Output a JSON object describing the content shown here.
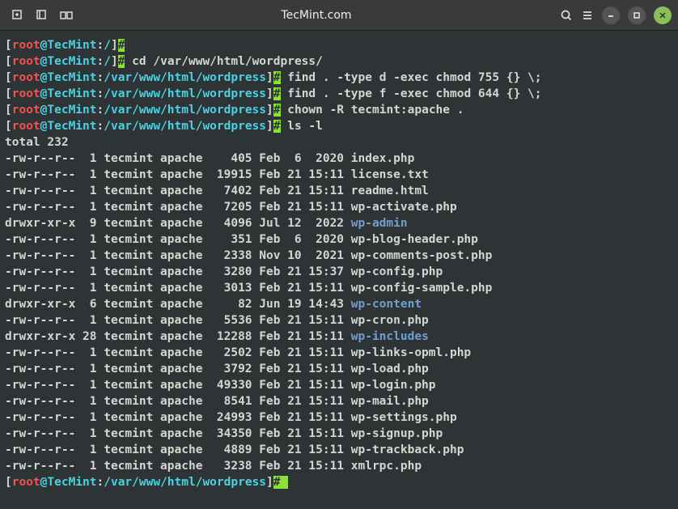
{
  "titlebar": {
    "title": "TecMint.com"
  },
  "prompts": [
    {
      "user": "root",
      "at": "@",
      "host": "TecMint",
      "sep": ":",
      "path": "/",
      "end": "]",
      "cmd": ""
    },
    {
      "user": "root",
      "at": "@",
      "host": "TecMint",
      "sep": ":",
      "path": "/",
      "end": "]",
      "cmd": " cd /var/www/html/wordpress/"
    },
    {
      "user": "root",
      "at": "@",
      "host": "TecMint",
      "sep": ":",
      "path": "/var/www/html/wordpress",
      "end": "]",
      "cmd": " find . -type d -exec chmod 755 {} \\;"
    },
    {
      "user": "root",
      "at": "@",
      "host": "TecMint",
      "sep": ":",
      "path": "/var/www/html/wordpress",
      "end": "]",
      "cmd": " find . -type f -exec chmod 644 {} \\;"
    },
    {
      "user": "root",
      "at": "@",
      "host": "TecMint",
      "sep": ":",
      "path": "/var/www/html/wordpress",
      "end": "]",
      "cmd": " chown -R tecmint:apache ."
    },
    {
      "user": "root",
      "at": "@",
      "host": "TecMint",
      "sep": ":",
      "path": "/var/www/html/wordpress",
      "end": "]",
      "cmd": " ls -l"
    }
  ],
  "total_line": "total 232",
  "files": [
    {
      "perm": "-rw-r--r--",
      "links": " 1",
      "user": "tecmint",
      "group": "apache",
      "size": "   405",
      "date": "Feb  6  2020",
      "name": "index.php",
      "dir": false
    },
    {
      "perm": "-rw-r--r--",
      "links": " 1",
      "user": "tecmint",
      "group": "apache",
      "size": " 19915",
      "date": "Feb 21 15:11",
      "name": "license.txt",
      "dir": false
    },
    {
      "perm": "-rw-r--r--",
      "links": " 1",
      "user": "tecmint",
      "group": "apache",
      "size": "  7402",
      "date": "Feb 21 15:11",
      "name": "readme.html",
      "dir": false
    },
    {
      "perm": "-rw-r--r--",
      "links": " 1",
      "user": "tecmint",
      "group": "apache",
      "size": "  7205",
      "date": "Feb 21 15:11",
      "name": "wp-activate.php",
      "dir": false
    },
    {
      "perm": "drwxr-xr-x",
      "links": " 9",
      "user": "tecmint",
      "group": "apache",
      "size": "  4096",
      "date": "Jul 12  2022",
      "name": "wp-admin",
      "dir": true
    },
    {
      "perm": "-rw-r--r--",
      "links": " 1",
      "user": "tecmint",
      "group": "apache",
      "size": "   351",
      "date": "Feb  6  2020",
      "name": "wp-blog-header.php",
      "dir": false
    },
    {
      "perm": "-rw-r--r--",
      "links": " 1",
      "user": "tecmint",
      "group": "apache",
      "size": "  2338",
      "date": "Nov 10  2021",
      "name": "wp-comments-post.php",
      "dir": false
    },
    {
      "perm": "-rw-r--r--",
      "links": " 1",
      "user": "tecmint",
      "group": "apache",
      "size": "  3280",
      "date": "Feb 21 15:37",
      "name": "wp-config.php",
      "dir": false
    },
    {
      "perm": "-rw-r--r--",
      "links": " 1",
      "user": "tecmint",
      "group": "apache",
      "size": "  3013",
      "date": "Feb 21 15:11",
      "name": "wp-config-sample.php",
      "dir": false
    },
    {
      "perm": "drwxr-xr-x",
      "links": " 6",
      "user": "tecmint",
      "group": "apache",
      "size": "    82",
      "date": "Jun 19 14:43",
      "name": "wp-content",
      "dir": true
    },
    {
      "perm": "-rw-r--r--",
      "links": " 1",
      "user": "tecmint",
      "group": "apache",
      "size": "  5536",
      "date": "Feb 21 15:11",
      "name": "wp-cron.php",
      "dir": false
    },
    {
      "perm": "drwxr-xr-x",
      "links": "28",
      "user": "tecmint",
      "group": "apache",
      "size": " 12288",
      "date": "Feb 21 15:11",
      "name": "wp-includes",
      "dir": true
    },
    {
      "perm": "-rw-r--r--",
      "links": " 1",
      "user": "tecmint",
      "group": "apache",
      "size": "  2502",
      "date": "Feb 21 15:11",
      "name": "wp-links-opml.php",
      "dir": false
    },
    {
      "perm": "-rw-r--r--",
      "links": " 1",
      "user": "tecmint",
      "group": "apache",
      "size": "  3792",
      "date": "Feb 21 15:11",
      "name": "wp-load.php",
      "dir": false
    },
    {
      "perm": "-rw-r--r--",
      "links": " 1",
      "user": "tecmint",
      "group": "apache",
      "size": " 49330",
      "date": "Feb 21 15:11",
      "name": "wp-login.php",
      "dir": false
    },
    {
      "perm": "-rw-r--r--",
      "links": " 1",
      "user": "tecmint",
      "group": "apache",
      "size": "  8541",
      "date": "Feb 21 15:11",
      "name": "wp-mail.php",
      "dir": false
    },
    {
      "perm": "-rw-r--r--",
      "links": " 1",
      "user": "tecmint",
      "group": "apache",
      "size": " 24993",
      "date": "Feb 21 15:11",
      "name": "wp-settings.php",
      "dir": false
    },
    {
      "perm": "-rw-r--r--",
      "links": " 1",
      "user": "tecmint",
      "group": "apache",
      "size": " 34350",
      "date": "Feb 21 15:11",
      "name": "wp-signup.php",
      "dir": false
    },
    {
      "perm": "-rw-r--r--",
      "links": " 1",
      "user": "tecmint",
      "group": "apache",
      "size": "  4889",
      "date": "Feb 21 15:11",
      "name": "wp-trackback.php",
      "dir": false
    },
    {
      "perm": "-rw-r--r--",
      "links": " 1",
      "user": "tecmint",
      "group": "apache",
      "size": "  3238",
      "date": "Feb 21 15:11",
      "name": "xmlrpc.php",
      "dir": false
    }
  ],
  "final_prompt": {
    "user": "root",
    "at": "@",
    "host": "TecMint",
    "sep": ":",
    "path": "/var/www/html/wordpress",
    "end": "]"
  }
}
